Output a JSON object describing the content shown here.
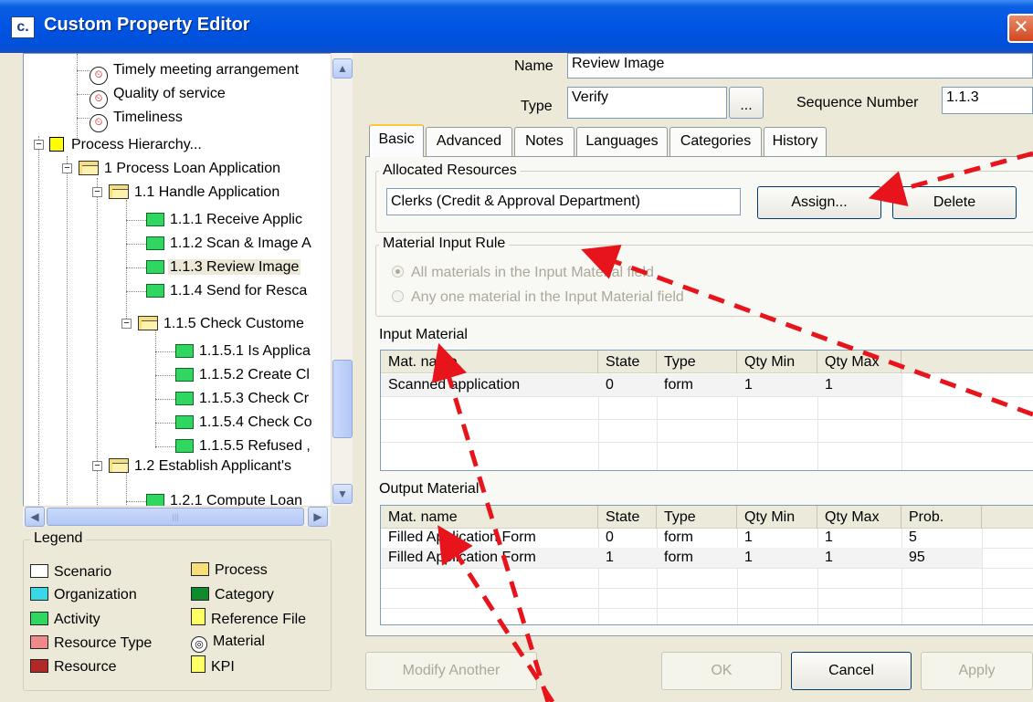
{
  "window": {
    "title": "Custom Property Editor",
    "icon_letter": "c.",
    "close_glyph": "✕"
  },
  "tree": {
    "items": [
      {
        "label": "Timely meeting arrangement",
        "icon": "kpi"
      },
      {
        "label": "Quality of service",
        "icon": "kpi"
      },
      {
        "label": "Timeliness",
        "icon": "kpi"
      },
      {
        "label": "Process Hierarchy...",
        "icon": "process"
      },
      {
        "label": "1 Process Loan Application",
        "icon": "folder"
      },
      {
        "label": "1.1 Handle Application",
        "icon": "folder"
      },
      {
        "label": "1.1.1 Receive Applic",
        "icon": "activity"
      },
      {
        "label": "1.1.2 Scan & Image A",
        "icon": "activity"
      },
      {
        "label": "1.1.3 Review Image",
        "icon": "activity",
        "selected": true
      },
      {
        "label": "1.1.4 Send for Resca",
        "icon": "activity"
      },
      {
        "label": "1.1.5 Check Custome",
        "icon": "folder"
      },
      {
        "label": "1.1.5.1 Is Applica",
        "icon": "activity"
      },
      {
        "label": "1.1.5.2 Create Cl",
        "icon": "activity"
      },
      {
        "label": "1.1.5.3 Check Cr",
        "icon": "activity"
      },
      {
        "label": "1.1.5.4 Check Co",
        "icon": "activity"
      },
      {
        "label": "1.1.5.5 Refused ,",
        "icon": "activity"
      },
      {
        "label": "1.2 Establish Applicant's",
        "icon": "folder"
      },
      {
        "label": "1.2.1 Compute Loan",
        "icon": "activity"
      }
    ]
  },
  "legend": {
    "title": "Legend",
    "items": [
      {
        "label": "Scenario",
        "color": "#ffffff"
      },
      {
        "label": "Process",
        "color": "#f6de7a"
      },
      {
        "label": "Organization",
        "color": "#3ad7e6"
      },
      {
        "label": "Category",
        "color": "#0f8a2c"
      },
      {
        "label": "Activity",
        "color": "#2fd65f"
      },
      {
        "label": "Reference File",
        "color": "#ffff66"
      },
      {
        "label": "Resource Type",
        "color": "#f08a8a"
      },
      {
        "label": "Material",
        "color": "#ffffff"
      },
      {
        "label": "Resource",
        "color": "#b02828"
      },
      {
        "label": "KPI",
        "color": "#ffff66"
      }
    ]
  },
  "form": {
    "name_label": "Name",
    "name_value": "Review Image",
    "type_label": "Type",
    "type_value": "Verify",
    "browse_label": "...",
    "seq_label": "Sequence Number",
    "seq_value": "1.1.3"
  },
  "tabs": [
    "Basic",
    "Advanced",
    "Notes",
    "Languages",
    "Categories",
    "History"
  ],
  "allocated": {
    "title": "Allocated Resources",
    "value": "Clerks (Credit & Approval Department)",
    "assign_label": "Assign...",
    "delete_label": "Delete"
  },
  "material_rule": {
    "title": "Material Input Rule",
    "option1": "All materials in the Input Material field",
    "option2": "Any one material in the Input Material field"
  },
  "input_material": {
    "title": "Input Material",
    "columns": [
      "Mat. name",
      "State",
      "Type",
      "Qty Min",
      "Qty Max"
    ],
    "rows": [
      [
        "Scanned application",
        "0",
        "form",
        "1",
        "1"
      ]
    ]
  },
  "output_material": {
    "title": "Output Material",
    "columns": [
      "Mat. name",
      "State",
      "Type",
      "Qty Min",
      "Qty Max",
      "Prob."
    ],
    "rows": [
      [
        "Filled Application Form",
        "0",
        "form",
        "1",
        "1",
        "5"
      ],
      [
        "Filled Application Form",
        "1",
        "form",
        "1",
        "1",
        "95"
      ]
    ]
  },
  "buttons": {
    "modify_another": "Modify Another",
    "ok": "OK",
    "cancel": "Cancel",
    "apply": "Apply"
  },
  "colors": {
    "title_bar": "#0054e3",
    "annotation_arrow": "#e8141c",
    "tab_highlight": "#ffc83c"
  }
}
